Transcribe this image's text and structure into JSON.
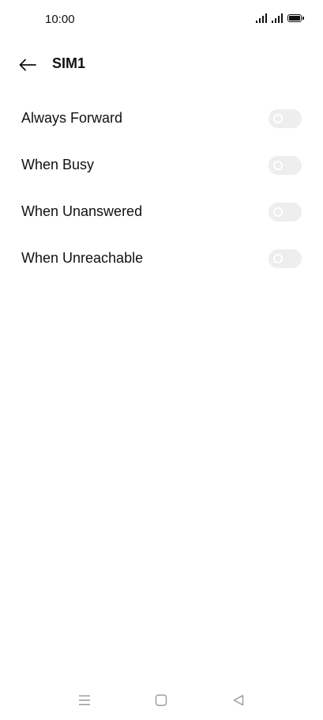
{
  "status_bar": {
    "time": "10:00",
    "icons": [
      "signal-icon",
      "signal-icon",
      "battery-icon"
    ]
  },
  "header": {
    "back_icon": "arrow-left-icon",
    "title": "SIM1"
  },
  "forwarding_options": [
    {
      "label": "Always Forward",
      "enabled": false
    },
    {
      "label": "When Busy",
      "enabled": false
    },
    {
      "label": "When Unanswered",
      "enabled": false
    },
    {
      "label": "When Unreachable",
      "enabled": false
    }
  ],
  "nav_bar": {
    "icons": [
      "menu-icon",
      "home-icon",
      "back-triangle-icon"
    ]
  },
  "colors": {
    "background": "#ffffff",
    "text": "#111111",
    "toggle_off_track": "#eeeeee",
    "nav_icon": "#9a9a9a"
  }
}
